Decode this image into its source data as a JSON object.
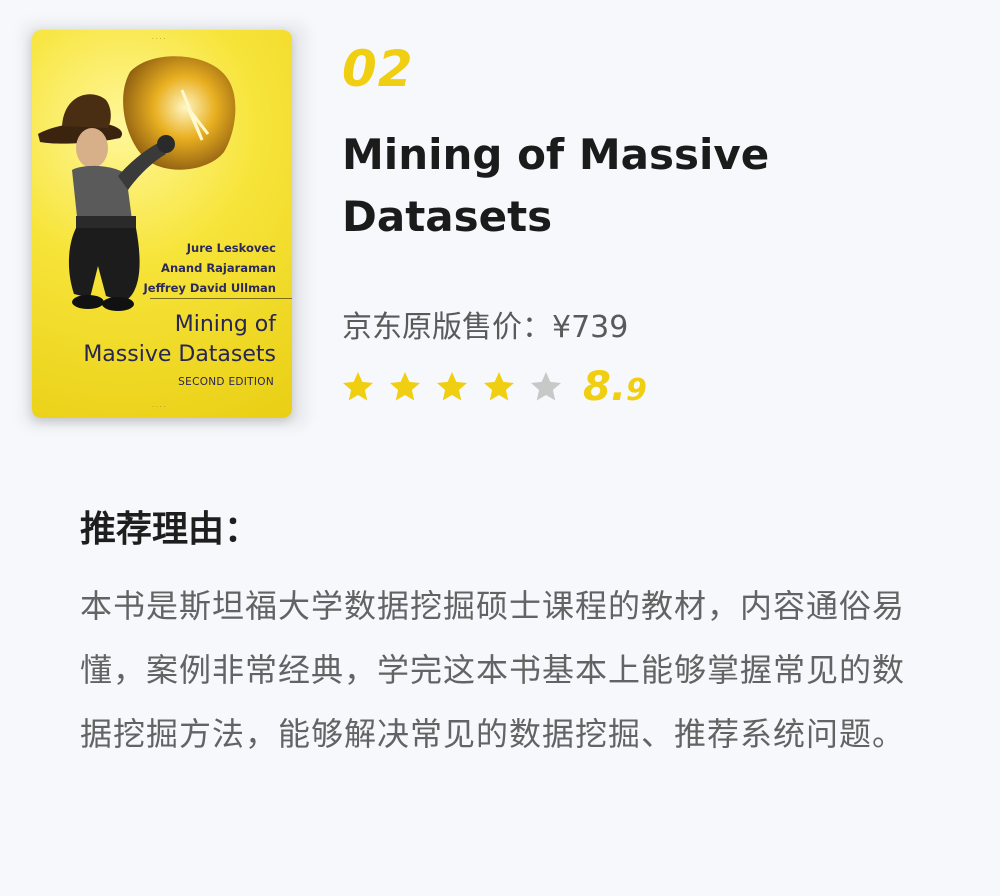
{
  "book": {
    "rank": "02",
    "title": "Mining of Massive Datasets",
    "price": "京东原版售价：¥739",
    "rating": {
      "value": 8.9,
      "integer_part": "8.",
      "decimal_part": "9",
      "filled_stars": 4,
      "total_stars": 5
    },
    "cover": {
      "authors": [
        "Jure Leskovec",
        "Anand Rajaraman",
        "Jeffrey David Ullman"
      ],
      "title_lines": [
        "Mining of",
        "Massive Datasets"
      ],
      "edition": "SECOND EDITION",
      "background_color": "#f2dc27"
    }
  },
  "reason": {
    "heading": "推荐理由：",
    "body": "本书是斯坦福大学数据挖掘硕士课程的教材，内容通俗易懂，案例非常经典，学完这本书基本上能够掌握常见的数据挖掘方法，能够解决常见的数据挖掘、推荐系统问题。"
  },
  "colors": {
    "accent": "#f0cf12",
    "star_empty": "#c8c8c8",
    "title": "#1b1b1b",
    "body_text": "#636363",
    "background": "#f6f8fb"
  }
}
